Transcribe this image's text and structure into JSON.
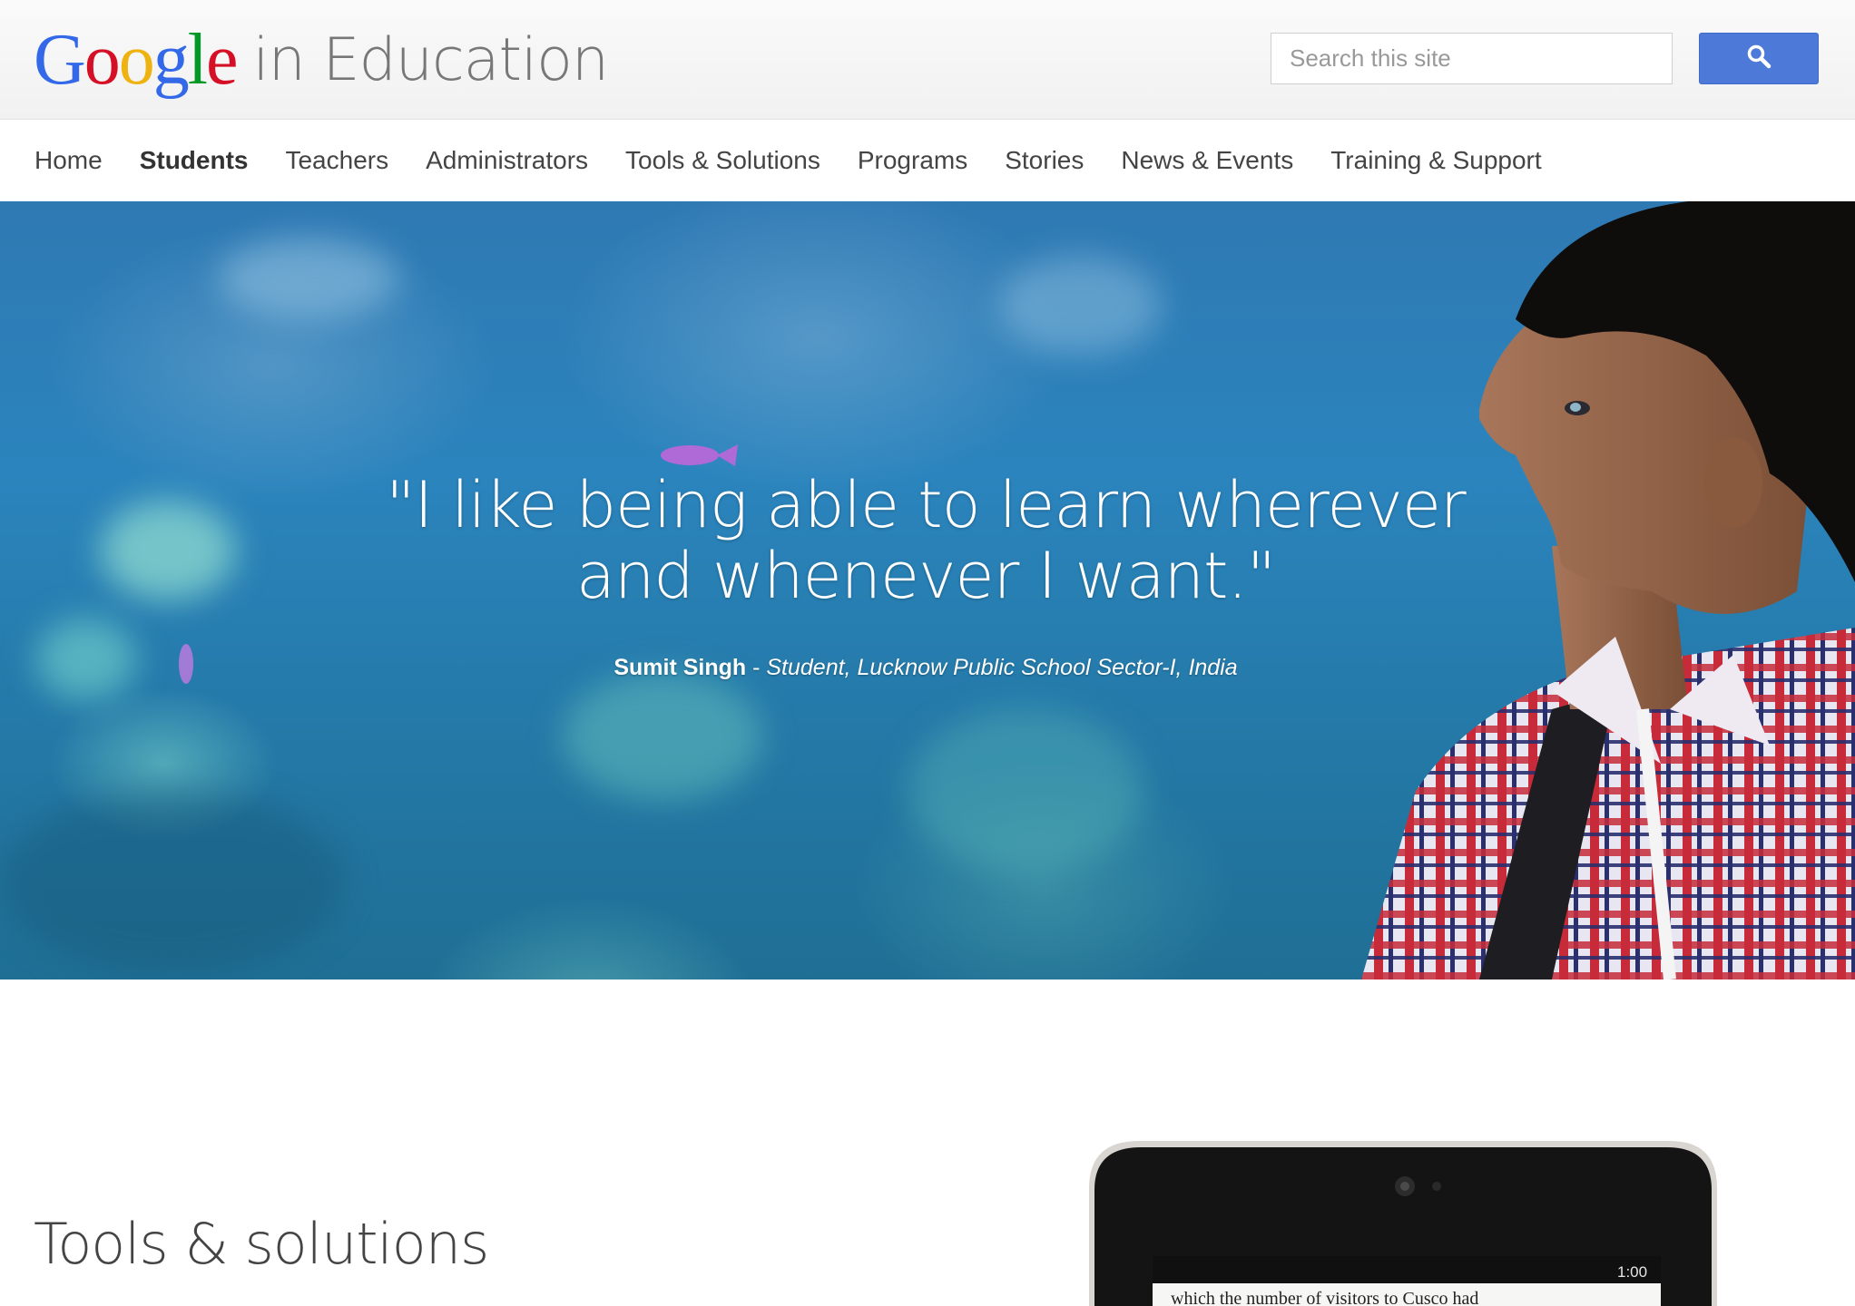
{
  "header": {
    "logo_text": "Google",
    "logo_suffix": "in Education",
    "search": {
      "placeholder": "Search this site"
    },
    "search_button_icon": "search-icon"
  },
  "nav": {
    "items": [
      {
        "label": "Home",
        "active": false
      },
      {
        "label": "Students",
        "active": true
      },
      {
        "label": "Teachers",
        "active": false
      },
      {
        "label": "Administrators",
        "active": false
      },
      {
        "label": "Tools & Solutions",
        "active": false
      },
      {
        "label": "Programs",
        "active": false
      },
      {
        "label": "Stories",
        "active": false
      },
      {
        "label": "News & Events",
        "active": false
      },
      {
        "label": "Training & Support",
        "active": false
      }
    ]
  },
  "hero": {
    "quote_line1": "\"I like being able to learn wherever",
    "quote_line2": "and whenever I want.\"",
    "attribution_name": "Sumit Singh",
    "attribution_separator": " - ",
    "attribution_role": "Student, Lucknow Public School Sector-I, India"
  },
  "content": {
    "section_title": "Tools & solutions",
    "tablet_status_time": "1:00",
    "tablet_text": "which the number of visitors to Cusco had"
  },
  "colors": {
    "google_blue": "#3369e8",
    "google_red": "#d50f25",
    "google_yellow": "#eeb211",
    "google_green": "#009925",
    "search_button": "#4d7ad9"
  }
}
